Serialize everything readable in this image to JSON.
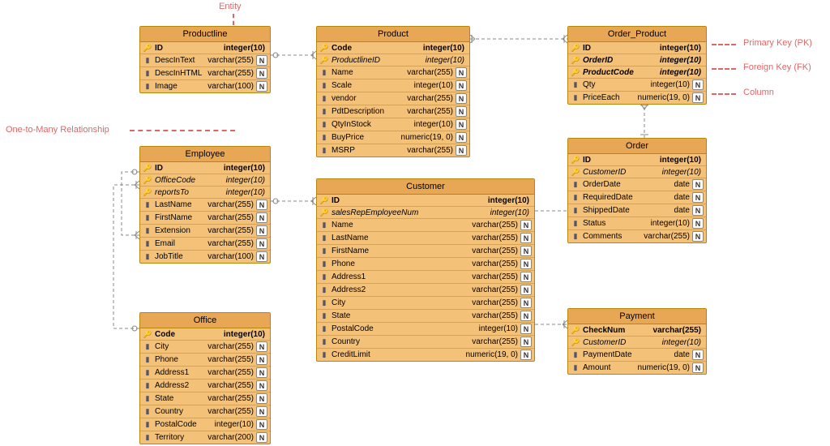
{
  "annotations": {
    "entity": "Entity",
    "one_to_many": "One-to-Many Relationship",
    "pk": "Primary Key (PK)",
    "fk": "Foreign Key (FK)",
    "column": "Column"
  },
  "entities": {
    "productline": {
      "title": "Productline",
      "cols": [
        {
          "icon": "pk",
          "name": "ID",
          "type": "integer(10)",
          "n": false,
          "bold": true
        },
        {
          "icon": "col",
          "name": "DescInText",
          "type": "varchar(255)",
          "n": true
        },
        {
          "icon": "col",
          "name": "DescInHTML",
          "type": "varchar(255)",
          "n": true
        },
        {
          "icon": "col",
          "name": "Image",
          "type": "varchar(100)",
          "n": true
        }
      ]
    },
    "product": {
      "title": "Product",
      "cols": [
        {
          "icon": "pk",
          "name": "Code",
          "type": "integer(10)",
          "n": false,
          "bold": true
        },
        {
          "icon": "fk",
          "name": "ProductlineID",
          "type": "integer(10)",
          "n": false,
          "italic": true
        },
        {
          "icon": "col",
          "name": "Name",
          "type": "varchar(255)",
          "n": true
        },
        {
          "icon": "col",
          "name": "Scale",
          "type": "integer(10)",
          "n": true
        },
        {
          "icon": "col",
          "name": "vendor",
          "type": "varchar(255)",
          "n": true
        },
        {
          "icon": "col",
          "name": "PdtDescription",
          "type": "varchar(255)",
          "n": true
        },
        {
          "icon": "col",
          "name": "QtyInStock",
          "type": "integer(10)",
          "n": true
        },
        {
          "icon": "col",
          "name": "BuyPrice",
          "type": "numeric(19, 0)",
          "n": true
        },
        {
          "icon": "col",
          "name": "MSRP",
          "type": "varchar(255)",
          "n": true
        }
      ]
    },
    "order_product": {
      "title": "Order_Product",
      "cols": [
        {
          "icon": "pk",
          "name": "ID",
          "type": "integer(10)",
          "n": false,
          "bold": true
        },
        {
          "icon": "fk",
          "name": "OrderID",
          "type": "integer(10)",
          "n": false,
          "bold": true,
          "italic": true
        },
        {
          "icon": "fk",
          "name": "ProductCode",
          "type": "integer(10)",
          "n": false,
          "bold": true,
          "italic": true
        },
        {
          "icon": "col",
          "name": "Qty",
          "type": "integer(10)",
          "n": true
        },
        {
          "icon": "col",
          "name": "PriceEach",
          "type": "numeric(19, 0)",
          "n": true
        }
      ]
    },
    "employee": {
      "title": "Employee",
      "cols": [
        {
          "icon": "pk",
          "name": "ID",
          "type": "integer(10)",
          "n": false,
          "bold": true
        },
        {
          "icon": "fk",
          "name": "OfficeCode",
          "type": "integer(10)",
          "n": false,
          "italic": true
        },
        {
          "icon": "fk",
          "name": "reportsTo",
          "type": "integer(10)",
          "n": false,
          "italic": true
        },
        {
          "icon": "col",
          "name": "LastName",
          "type": "varchar(255)",
          "n": true
        },
        {
          "icon": "col",
          "name": "FirstName",
          "type": "varchar(255)",
          "n": true
        },
        {
          "icon": "col",
          "name": "Extension",
          "type": "varchar(255)",
          "n": true
        },
        {
          "icon": "col",
          "name": "Email",
          "type": "varchar(255)",
          "n": true
        },
        {
          "icon": "col",
          "name": "JobTitle",
          "type": "varchar(100)",
          "n": true
        }
      ]
    },
    "customer": {
      "title": "Customer",
      "cols": [
        {
          "icon": "pk",
          "name": "ID",
          "type": "integer(10)",
          "n": false,
          "bold": true
        },
        {
          "icon": "fk",
          "name": "salesRepEmployeeNum",
          "type": "integer(10)",
          "n": false,
          "italic": true
        },
        {
          "icon": "col",
          "name": "Name",
          "type": "varchar(255)",
          "n": true
        },
        {
          "icon": "col",
          "name": "LastName",
          "type": "varchar(255)",
          "n": true
        },
        {
          "icon": "col",
          "name": "FirstName",
          "type": "varchar(255)",
          "n": true
        },
        {
          "icon": "col",
          "name": "Phone",
          "type": "varchar(255)",
          "n": true
        },
        {
          "icon": "col",
          "name": "Address1",
          "type": "varchar(255)",
          "n": true
        },
        {
          "icon": "col",
          "name": "Address2",
          "type": "varchar(255)",
          "n": true
        },
        {
          "icon": "col",
          "name": "City",
          "type": "varchar(255)",
          "n": true
        },
        {
          "icon": "col",
          "name": "State",
          "type": "varchar(255)",
          "n": true
        },
        {
          "icon": "col",
          "name": "PostalCode",
          "type": "integer(10)",
          "n": true
        },
        {
          "icon": "col",
          "name": "Country",
          "type": "varchar(255)",
          "n": true
        },
        {
          "icon": "col",
          "name": "CreditLimit",
          "type": "numeric(19, 0)",
          "n": true
        }
      ]
    },
    "order": {
      "title": "Order",
      "cols": [
        {
          "icon": "pk",
          "name": "ID",
          "type": "integer(10)",
          "n": false,
          "bold": true
        },
        {
          "icon": "fk",
          "name": "CustomerID",
          "type": "integer(10)",
          "n": false,
          "italic": true
        },
        {
          "icon": "col",
          "name": "OrderDate",
          "type": "date",
          "n": true
        },
        {
          "icon": "col",
          "name": "RequiredDate",
          "type": "date",
          "n": true
        },
        {
          "icon": "col",
          "name": "ShippedDate",
          "type": "date",
          "n": true
        },
        {
          "icon": "col",
          "name": "Status",
          "type": "integer(10)",
          "n": true
        },
        {
          "icon": "col",
          "name": "Comments",
          "type": "varchar(255)",
          "n": true
        }
      ]
    },
    "office": {
      "title": "Office",
      "cols": [
        {
          "icon": "pk",
          "name": "Code",
          "type": "integer(10)",
          "n": false,
          "bold": true
        },
        {
          "icon": "col",
          "name": "City",
          "type": "varchar(255)",
          "n": true
        },
        {
          "icon": "col",
          "name": "Phone",
          "type": "varchar(255)",
          "n": true
        },
        {
          "icon": "col",
          "name": "Address1",
          "type": "varchar(255)",
          "n": true
        },
        {
          "icon": "col",
          "name": "Address2",
          "type": "varchar(255)",
          "n": true
        },
        {
          "icon": "col",
          "name": "State",
          "type": "varchar(255)",
          "n": true
        },
        {
          "icon": "col",
          "name": "Country",
          "type": "varchar(255)",
          "n": true
        },
        {
          "icon": "col",
          "name": "PostalCode",
          "type": "integer(10)",
          "n": true
        },
        {
          "icon": "col",
          "name": "Territory",
          "type": "varchar(200)",
          "n": true
        }
      ]
    },
    "payment": {
      "title": "Payment",
      "cols": [
        {
          "icon": "pk",
          "name": "CheckNum",
          "type": "varchar(255)",
          "n": false,
          "bold": true
        },
        {
          "icon": "fk",
          "name": "CustomerID",
          "type": "integer(10)",
          "n": false,
          "italic": true
        },
        {
          "icon": "col",
          "name": "PaymentDate",
          "type": "date",
          "n": true
        },
        {
          "icon": "col",
          "name": "Amount",
          "type": "numeric(19, 0)",
          "n": true
        }
      ]
    }
  }
}
